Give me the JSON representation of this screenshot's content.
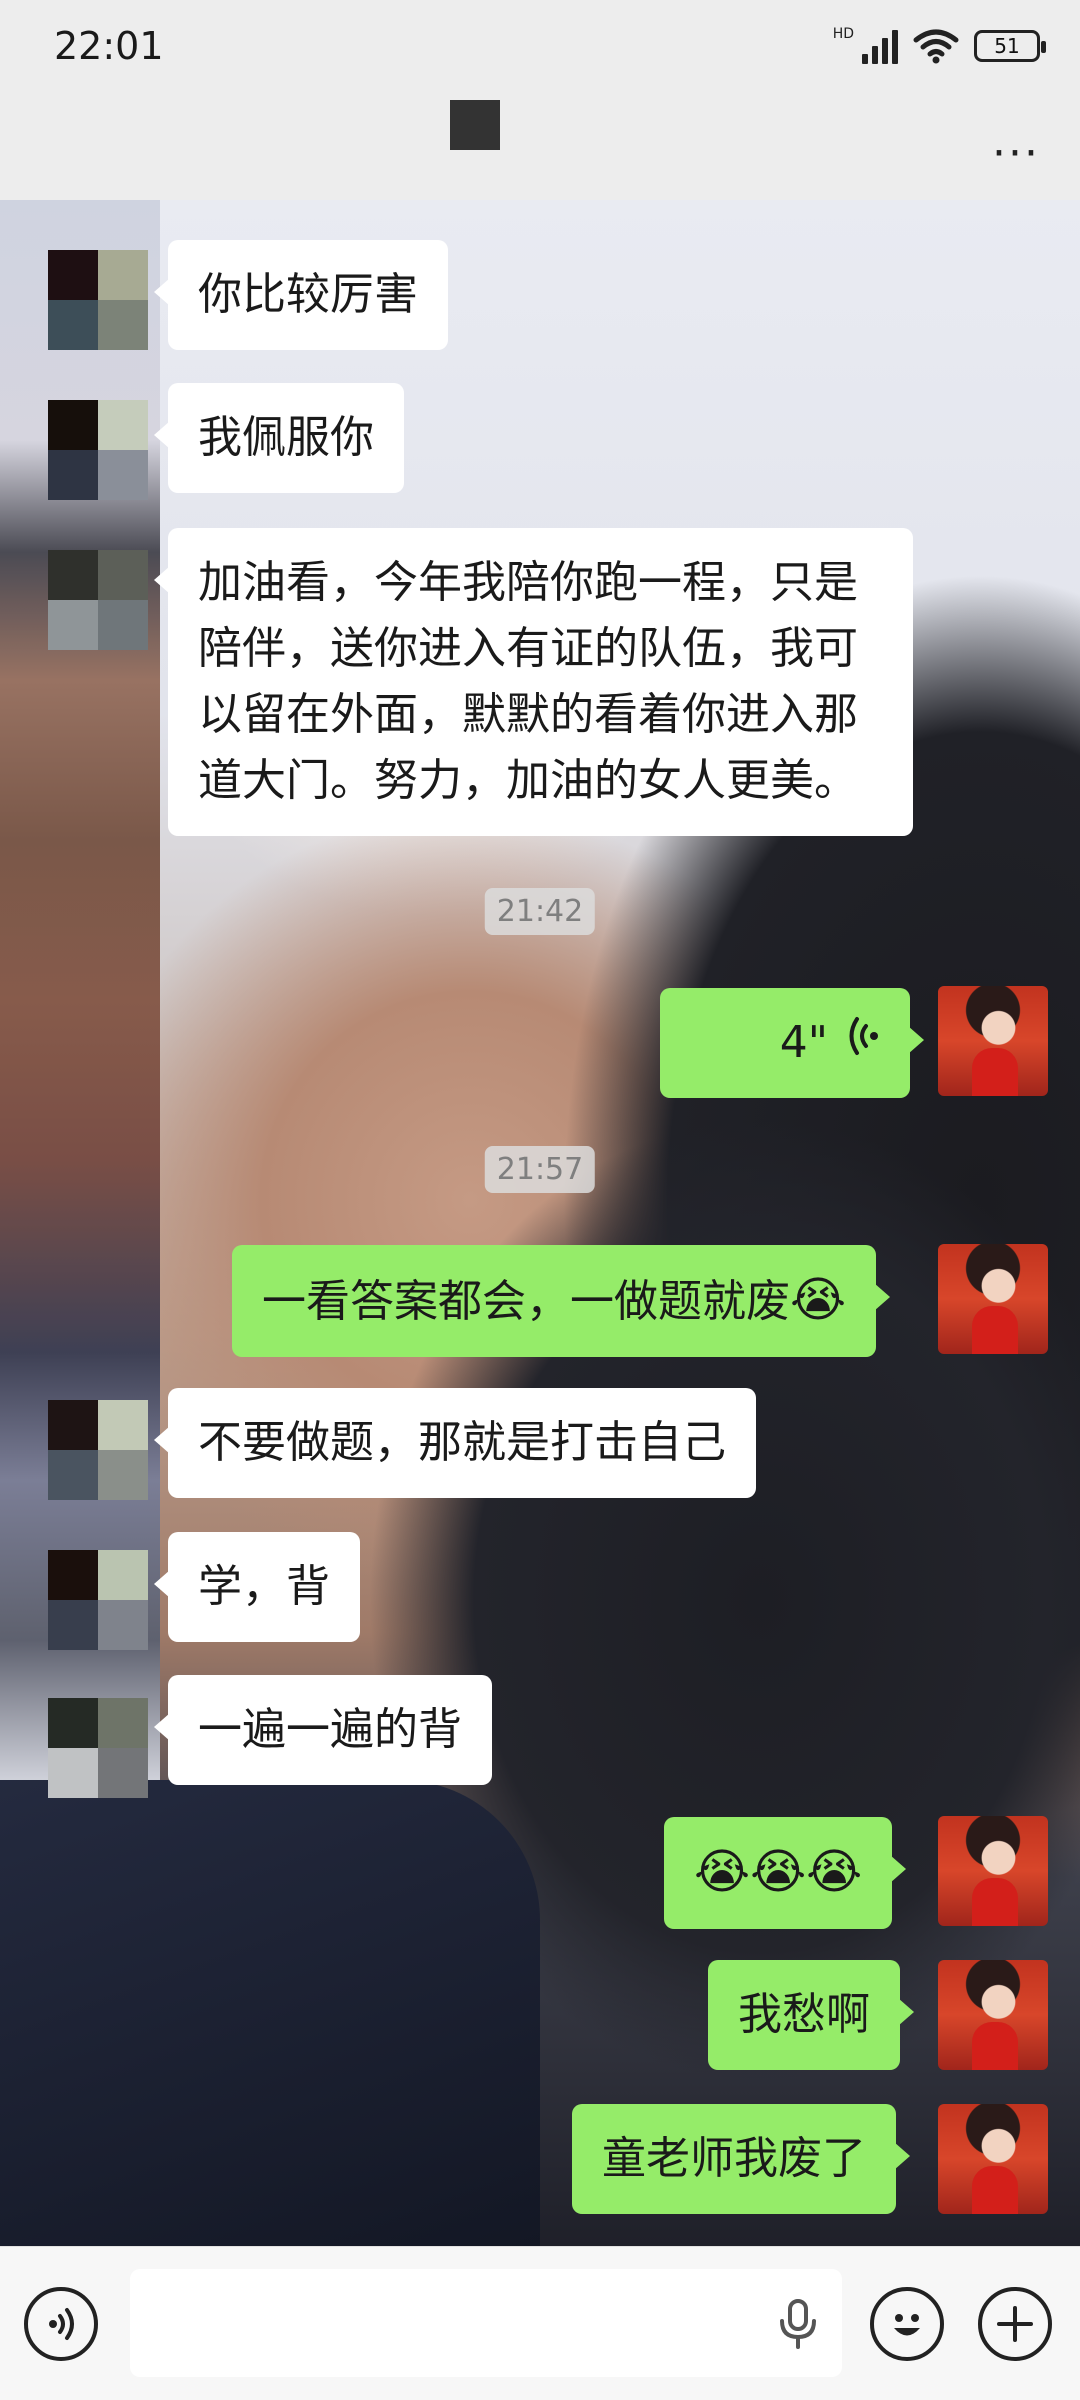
{
  "status_bar": {
    "time": "22:01",
    "network": "HD",
    "battery": "51",
    "icons": [
      "signal-icon",
      "wifi-icon",
      "battery-icon"
    ]
  },
  "header": {
    "title": "",
    "menu_icon": "more-icon"
  },
  "messages": [
    {
      "side": "left",
      "type": "text",
      "text": "你比较厉害"
    },
    {
      "side": "left",
      "type": "text",
      "text": "我佩服你"
    },
    {
      "side": "left",
      "type": "text",
      "text": "加油看，今年我陪你跑一程，只是陪伴，送你进入有证的队伍，我可以留在外面，默默的看着你进入那道大门。努力，加油的女人更美。"
    },
    {
      "type": "timestamp",
      "text": "21:42"
    },
    {
      "side": "right",
      "type": "voice",
      "duration": "4\""
    },
    {
      "type": "timestamp",
      "text": "21:57"
    },
    {
      "side": "right",
      "type": "text",
      "text": "一看答案都会，一做题就废",
      "emoji": "😭"
    },
    {
      "side": "left",
      "type": "text",
      "text": "不要做题，那就是打击自己"
    },
    {
      "side": "left",
      "type": "text",
      "text": "学，背"
    },
    {
      "side": "left",
      "type": "text",
      "text": "一遍一遍的背"
    },
    {
      "side": "right",
      "type": "text",
      "text": "😭😭😭"
    },
    {
      "side": "right",
      "type": "text",
      "text": "我愁啊"
    },
    {
      "side": "right",
      "type": "text",
      "text": "童老师我废了"
    }
  ],
  "input_bar": {
    "placeholder": "",
    "icons": [
      "voice-mode-icon",
      "microphone-icon",
      "emoji-icon",
      "plus-icon"
    ]
  }
}
